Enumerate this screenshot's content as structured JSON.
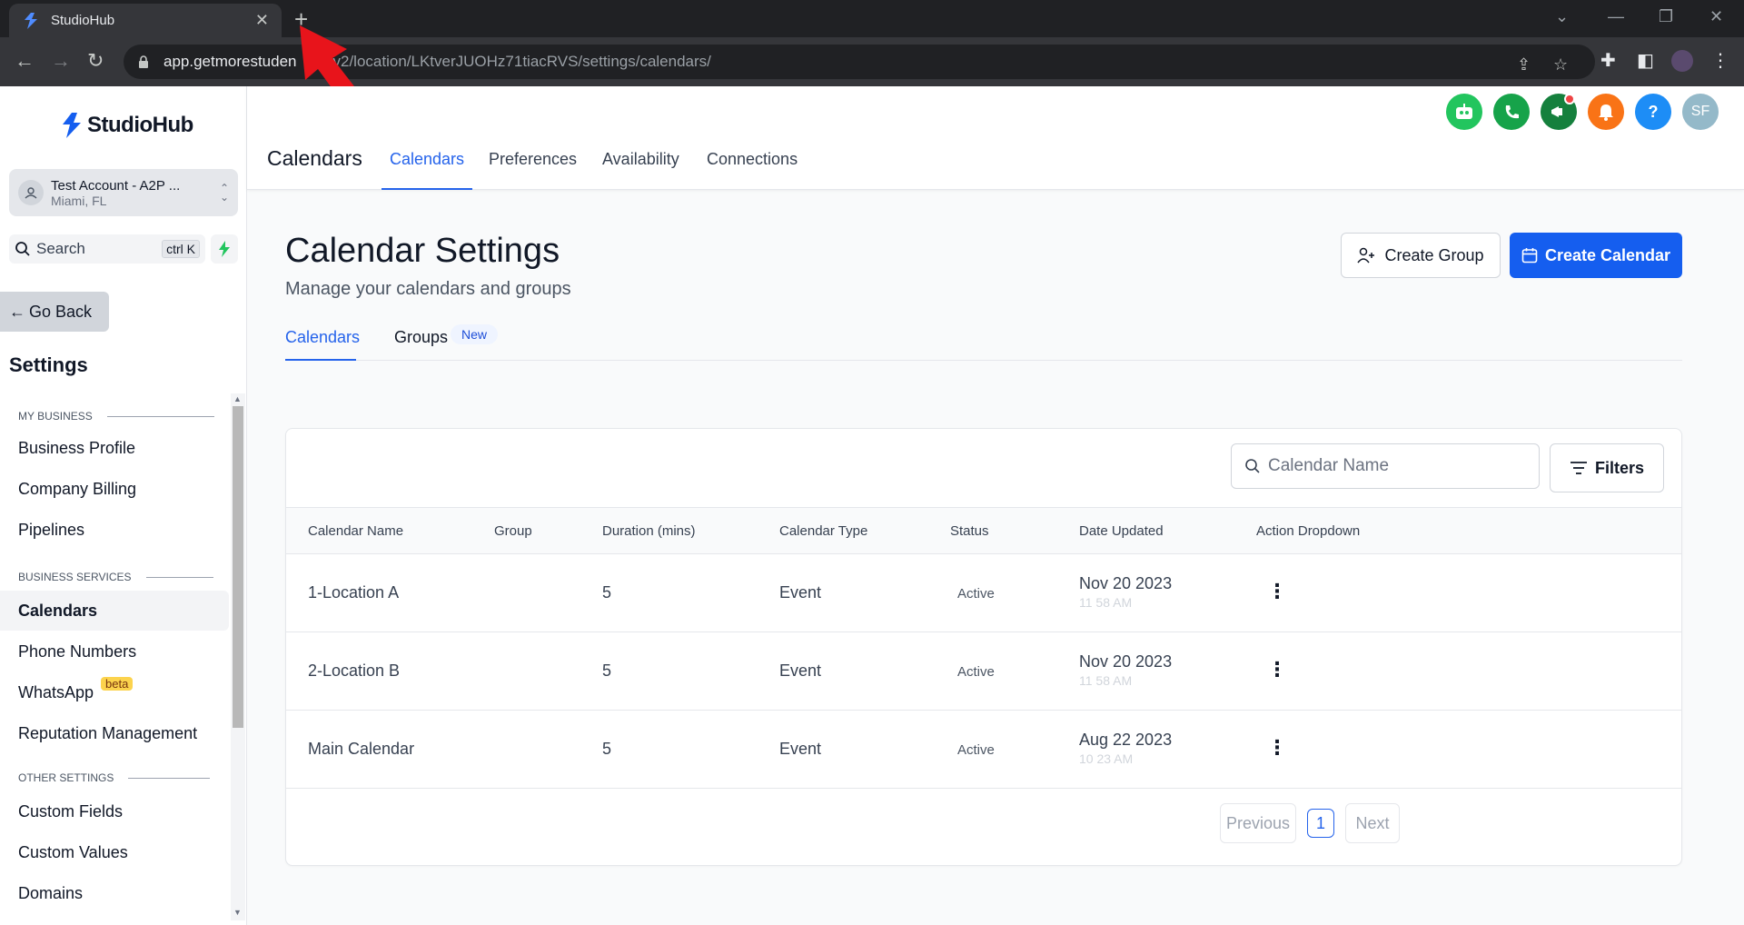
{
  "browser": {
    "tab_title": "StudioHub",
    "url_host": "app.getmorestuden",
    "url_path": "v2/location/LKtverJUOHz71tiacRVS/settings/calendars/"
  },
  "brand": {
    "name": "StudioHub",
    "color": "#155eef"
  },
  "account": {
    "name": "Test Account - A2P ...",
    "location": "Miami, FL"
  },
  "sidebar": {
    "search_label": "Search",
    "search_shortcut": "ctrl K",
    "go_back": "Go Back",
    "title": "Settings",
    "sections": [
      {
        "label": "MY BUSINESS"
      },
      {
        "label": "BUSINESS SERVICES"
      },
      {
        "label": "OTHER SETTINGS"
      }
    ],
    "items": [
      {
        "label": "Business Profile"
      },
      {
        "label": "Company Billing"
      },
      {
        "label": "Pipelines"
      },
      {
        "label": "Calendars"
      },
      {
        "label": "Phone Numbers"
      },
      {
        "label": "WhatsApp",
        "badge": "beta"
      },
      {
        "label": "Reputation Management"
      },
      {
        "label": "Custom Fields"
      },
      {
        "label": "Custom Values"
      },
      {
        "label": "Domains"
      }
    ]
  },
  "header": {
    "title": "Calendars",
    "tabs": [
      {
        "label": "Calendars"
      },
      {
        "label": "Preferences"
      },
      {
        "label": "Availability"
      },
      {
        "label": "Connections"
      }
    ],
    "avatar_initials": "SF",
    "help_label": "?"
  },
  "page": {
    "title": "Calendar Settings",
    "subtitle": "Manage your calendars and groups",
    "create_group": "Create Group",
    "create_calendar": "Create Calendar",
    "subtabs": [
      {
        "label": "Calendars"
      },
      {
        "label": "Groups",
        "badge": "New"
      }
    ]
  },
  "table": {
    "search_placeholder": "Calendar Name",
    "filters_label": "Filters",
    "columns": [
      "Calendar Name",
      "Group",
      "Duration (mins)",
      "Calendar Type",
      "Status",
      "Date Updated",
      "Action Dropdown"
    ],
    "rows": [
      {
        "name": "1-Location A",
        "group": "",
        "duration": "5",
        "type": "Event",
        "status": "Active",
        "date": "Nov 20 2023",
        "time": "11 58 AM"
      },
      {
        "name": "2-Location B",
        "group": "",
        "duration": "5",
        "type": "Event",
        "status": "Active",
        "date": "Nov 20 2023",
        "time": "11 58 AM"
      },
      {
        "name": "Main Calendar",
        "group": "",
        "duration": "5",
        "type": "Event",
        "status": "Active",
        "date": "Aug 22 2023",
        "time": "10 23 AM"
      }
    ],
    "pagination": {
      "previous": "Previous",
      "current": "1",
      "next": "Next"
    }
  }
}
